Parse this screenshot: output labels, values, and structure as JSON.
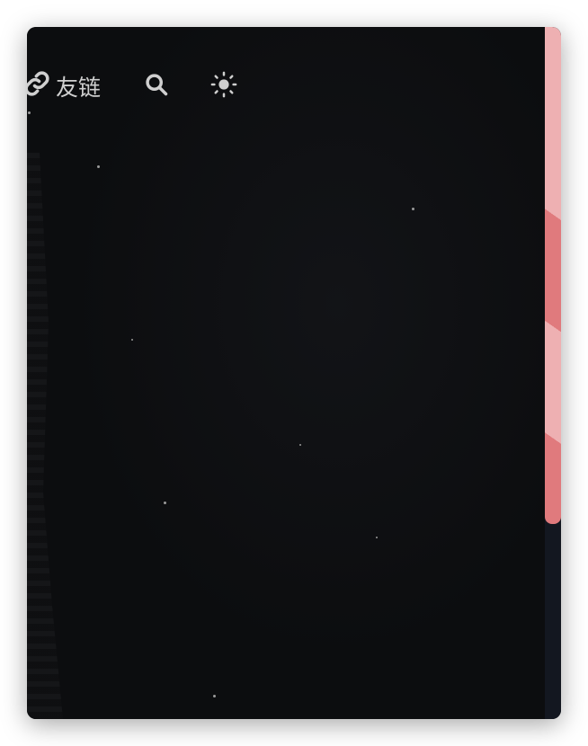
{
  "nav": {
    "friends_label": "友链",
    "friends_icon": "link-icon",
    "search_icon": "search-icon",
    "theme_icon": "sun-icon"
  },
  "theme": {
    "background": "#0c0d0f",
    "nav_text_color": "#cfcfcf",
    "scrollbar_track": "#131720",
    "scrollbar_thumb_dark": "#e07a7d",
    "scrollbar_thumb_light": "#eeb0b2"
  }
}
